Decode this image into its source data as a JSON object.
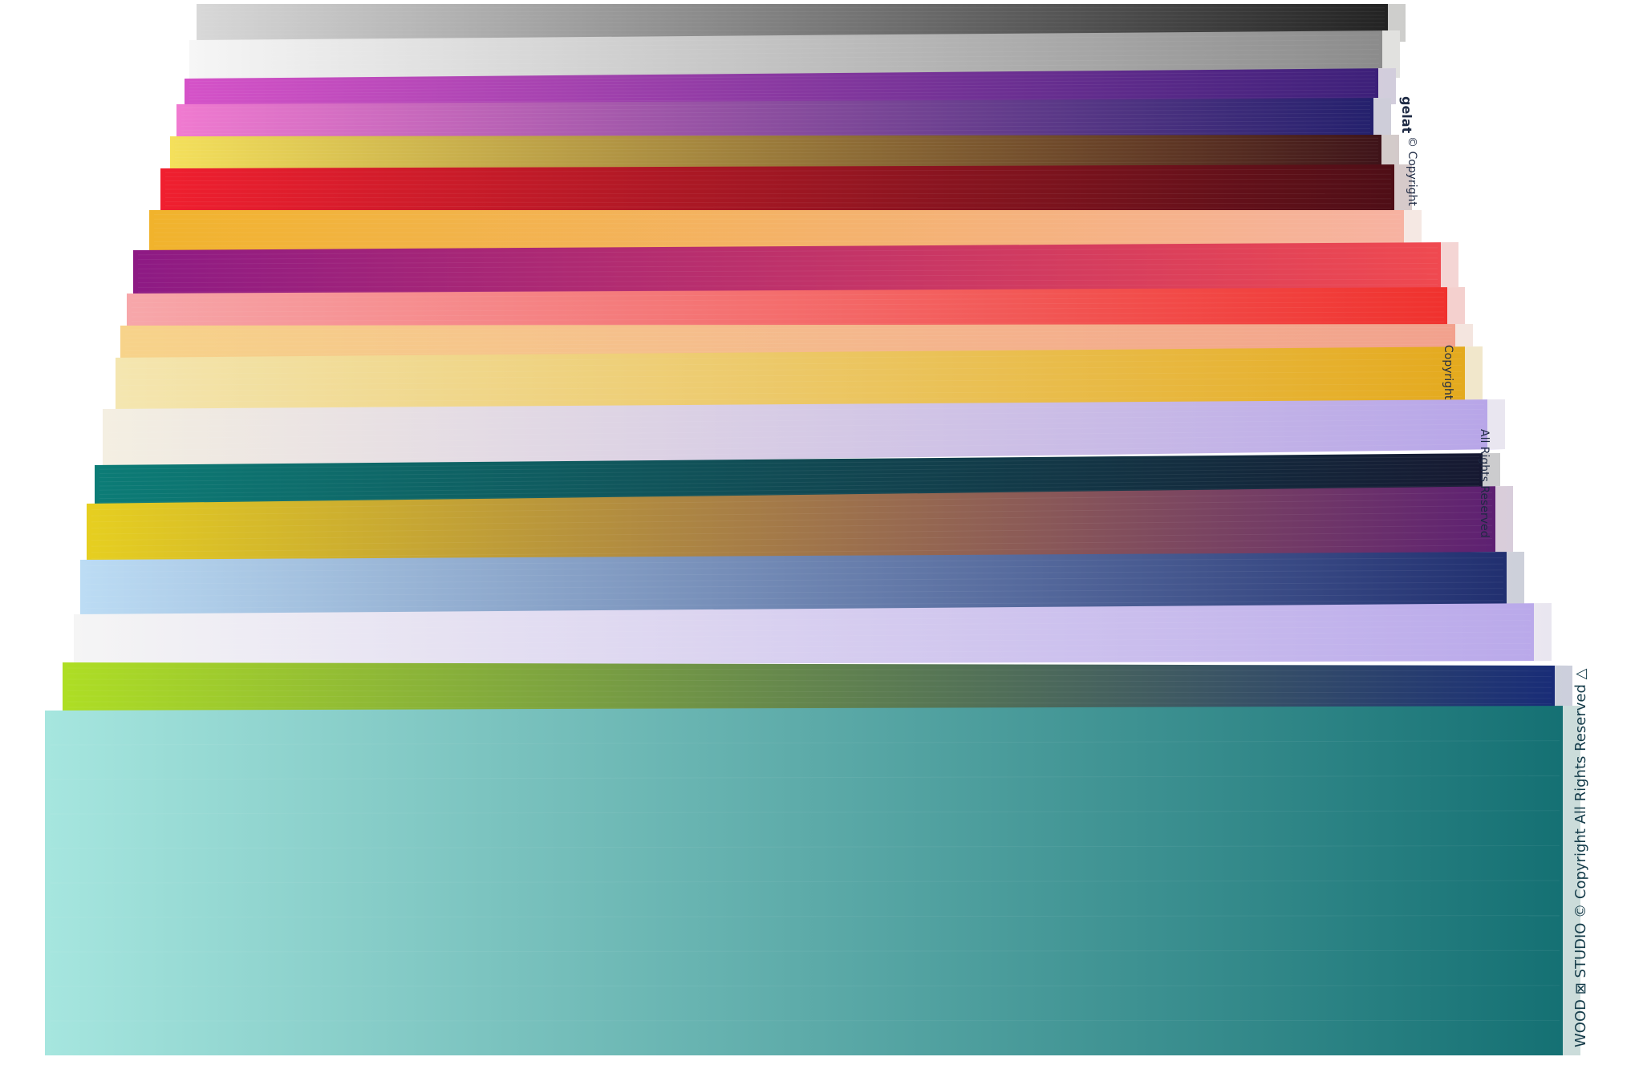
{
  "image": {
    "description_colors": {
      "background": "#ffffff",
      "selvage": "#f4f4f2"
    }
  },
  "fabric_strips": [
    {
      "name": "black-gray",
      "from": "#d8d8d8",
      "to": "#202020"
    },
    {
      "name": "white-gray",
      "from": "#f6f6f6",
      "to": "#8a8a8a"
    },
    {
      "name": "magenta-purple",
      "from": "#d552c8",
      "to": "#3a1f78"
    },
    {
      "name": "pink-navy",
      "from": "#f07ad0",
      "to": "#211f6b"
    },
    {
      "name": "yellow-wine",
      "from": "#f4e05b",
      "to": "#3c1018"
    },
    {
      "name": "red-maroon",
      "from": "#f01f2f",
      "to": "#4c0e16"
    },
    {
      "name": "gold-salmon",
      "from": "#f1b32c",
      "to": "#f7b2a3"
    },
    {
      "name": "purple-coral",
      "from": "#8d1a84",
      "to": "#f14a4f"
    },
    {
      "name": "pink-red",
      "from": "#f7a7aa",
      "to": "#f0302c"
    },
    {
      "name": "peach-pink",
      "from": "#f7d38a",
      "to": "#f2a08d"
    },
    {
      "name": "cream-gold",
      "from": "#f4e6b0",
      "to": "#e4a91c"
    },
    {
      "name": "ivory-lavender",
      "from": "#f4efe2",
      "to": "#b7a5e8"
    },
    {
      "name": "teal-navy",
      "from": "#0c7c76",
      "to": "#161730"
    },
    {
      "name": "lime-purple",
      "from": "#e6cf20",
      "to": "#5c1e73"
    },
    {
      "name": "sky-navy",
      "from": "#bcdcf4",
      "to": "#1f2d6e"
    },
    {
      "name": "white-lilac",
      "from": "#f5f5f5",
      "to": "#b9a8ea"
    },
    {
      "name": "lime-navy",
      "from": "#aede24",
      "to": "#172a78"
    },
    {
      "name": "aqua-teal",
      "from": "#a6e6df",
      "to": "#136f72"
    }
  ],
  "selvage": {
    "top_label": "gelat",
    "top_copyright": "© Copyright",
    "mid_copyright": "Copyright",
    "mid_rights": "All Rights Reserved",
    "bottom_text": "WOOD ⊠ STUDIO © Copyright All Rights Reserved △"
  }
}
